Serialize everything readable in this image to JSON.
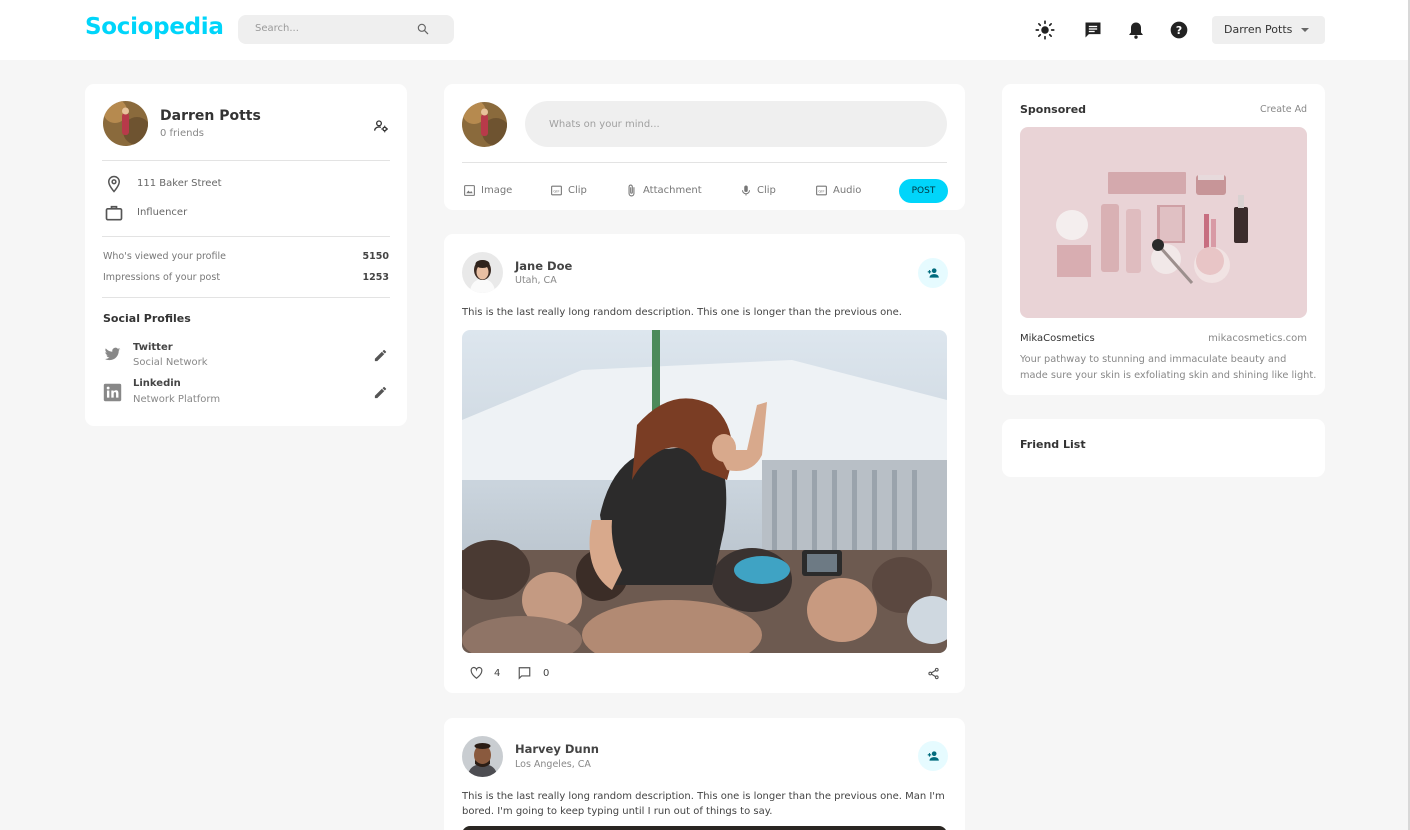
{
  "app": {
    "logo": "Sociopedia",
    "search_placeholder": "Search...",
    "user_name": "Darren Potts"
  },
  "colors": {
    "accent": "#00d5fa",
    "accent_light": "#e6fbff",
    "background": "#f6f6f6",
    "card": "#ffffff"
  },
  "icons": [
    "search-icon",
    "light-mode-icon",
    "message-icon",
    "notifications-icon",
    "help-icon",
    "manage-accounts-icon",
    "location-icon",
    "work-icon",
    "twitter-icon",
    "linkedin-icon",
    "edit-icon",
    "image-icon",
    "clip-icon",
    "attachment-icon",
    "mic-icon",
    "audio-icon",
    "add-friend-icon",
    "heart-icon",
    "comment-icon",
    "share-icon"
  ],
  "profile": {
    "name": "Darren Potts",
    "friends": "0 friends",
    "location": "111 Baker Street",
    "occupation": "Influencer",
    "stats": [
      {
        "label": "Who's viewed your profile",
        "value": "5150"
      },
      {
        "label": "Impressions of your post",
        "value": "1253"
      }
    ],
    "social_title": "Social Profiles",
    "socials": [
      {
        "name": "Twitter",
        "type": "Social Network"
      },
      {
        "name": "Linkedin",
        "type": "Network Platform"
      }
    ]
  },
  "composer": {
    "placeholder": "Whats on your mind...",
    "actions": [
      "Image",
      "Clip",
      "Attachment",
      "Clip",
      "Audio"
    ],
    "post_label": "POST"
  },
  "posts": [
    {
      "author": "Jane Doe",
      "location": "Utah, CA",
      "description": "This is the last really long random description. This one is longer than the previous one.",
      "likes": "4",
      "comments": "0"
    },
    {
      "author": "Harvey Dunn",
      "location": "Los Angeles, CA",
      "description_line1": "This is the last really long random description. This one is longer than the previous one. Man I'm",
      "description_line2": "bored. I'm going to keep typing until I run out of things to say."
    }
  ],
  "sponsored": {
    "title": "Sponsored",
    "create_ad": "Create Ad",
    "brand": "MikaCosmetics",
    "url": "mikacosmetics.com",
    "description_line1": "Your pathway to stunning and immaculate beauty and",
    "description_line2": "made sure your skin is exfoliating skin and shining like light."
  },
  "friend_list": {
    "title": "Friend List"
  }
}
